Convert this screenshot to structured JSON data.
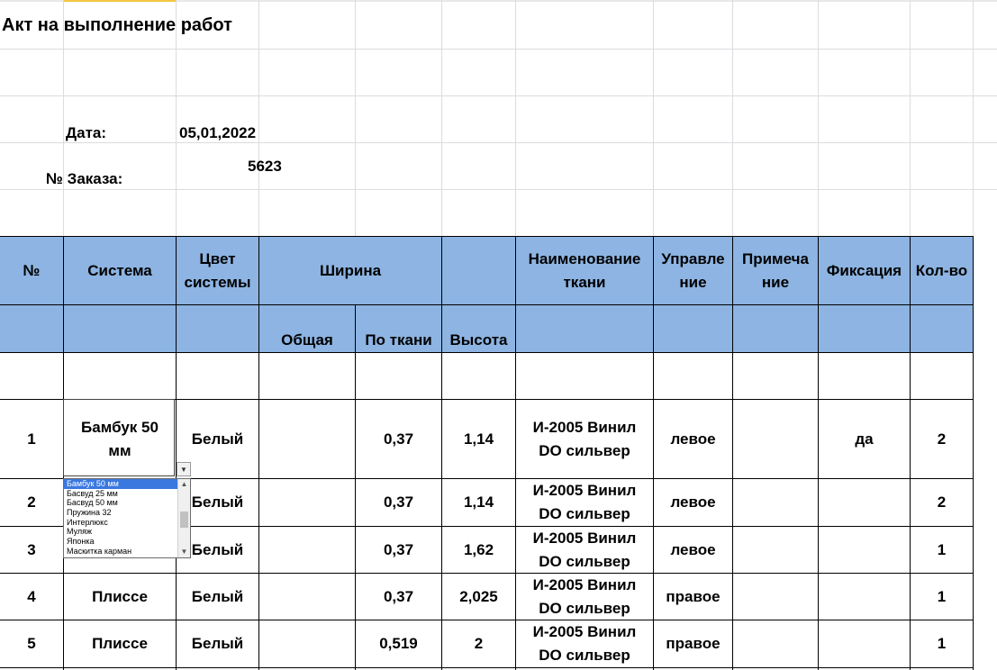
{
  "document": {
    "title": "Акт на выполнение работ",
    "date_label": "Дата:",
    "date_value": "05,01,2022",
    "order_label": "№ Заказа:",
    "order_value": "5623"
  },
  "table": {
    "header": {
      "num": "№",
      "system": "Система",
      "color_l1": "Цвет",
      "color_l2": "системы",
      "width": "Ширина",
      "fabric_l1": "Наименование",
      "fabric_l2": "ткани",
      "control_l1": "Управле",
      "control_l2": "ние",
      "note_l1": "Примеча",
      "note_l2": "ние",
      "fixation": "Фиксация",
      "qty": "Кол-во",
      "width_total": "Общая",
      "width_fabric": "По ткани",
      "height": "Высота"
    },
    "rows": [
      {
        "num": "1",
        "system_l1": "Бамбук 50",
        "system_l2": "мм",
        "color": "Белый",
        "total": "",
        "by_fabric": "0,37",
        "height": "1,14",
        "fabric_l1": "И-2005 Винил",
        "fabric_l2": "DO сильвер",
        "control": "левое",
        "note": "",
        "fixation": "да",
        "qty": "2"
      },
      {
        "num": "2",
        "system_l1": "",
        "system_l2": "",
        "color": "Белый",
        "total": "",
        "by_fabric": "0,37",
        "height": "1,14",
        "fabric_l1": "И-2005 Винил",
        "fabric_l2": "DO сильвер",
        "control": "левое",
        "note": "",
        "fixation": "",
        "qty": "2"
      },
      {
        "num": "3",
        "system_l1": "",
        "system_l2": "",
        "color": "Белый",
        "total": "",
        "by_fabric": "0,37",
        "height": "1,62",
        "fabric_l1": "И-2005 Винил",
        "fabric_l2": "DO сильвер",
        "control": "левое",
        "note": "",
        "fixation": "",
        "qty": "1"
      },
      {
        "num": "4",
        "system_l1": "Плиссе",
        "system_l2": "",
        "color": "Белый",
        "total": "",
        "by_fabric": "0,37",
        "height": "2,025",
        "fabric_l1": "И-2005 Винил",
        "fabric_l2": "DO сильвер",
        "control": "правое",
        "note": "",
        "fixation": "",
        "qty": "1"
      },
      {
        "num": "5",
        "system_l1": "Плиссе",
        "system_l2": "",
        "color": "Белый",
        "total": "",
        "by_fabric": "0,519",
        "height": "2",
        "fabric_l1": "И-2005 Винил",
        "fabric_l2": "DO сильвер",
        "control": "правое",
        "note": "",
        "fixation": "",
        "qty": "1"
      }
    ]
  },
  "dropdown": {
    "selected": "Бамбук 50 мм",
    "options": [
      "Бамбук 50 мм",
      "Басвуд 25 мм",
      "Басвуд 50 мм",
      "Пружина 32",
      "Интерлюкс",
      "Муляж",
      "Японка",
      "Маскитка карман"
    ],
    "arrow_down_icon": "chevron-down-icon"
  },
  "colors": {
    "header_fill": "#8db4e2",
    "selection": "#3a78e0",
    "gridline": "#dadcdf"
  }
}
